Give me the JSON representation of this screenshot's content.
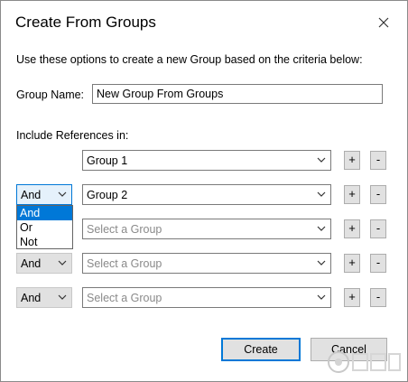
{
  "dialog": {
    "title": "Create From Groups",
    "description": "Use these options to create a new Group based on the criteria below:",
    "group_name_label": "Group Name:",
    "group_name_value": "New Group From Groups",
    "include_label": "Include References in:"
  },
  "rows": [
    {
      "operator": "",
      "group": "Group 1",
      "placeholder": false
    },
    {
      "operator": "And",
      "group": "Group 2",
      "placeholder": false
    },
    {
      "operator": "",
      "group": "Select a Group",
      "placeholder": true
    },
    {
      "operator": "And",
      "group": "Select a Group",
      "placeholder": true
    },
    {
      "operator": "And",
      "group": "Select a Group",
      "placeholder": true
    }
  ],
  "row_buttons": {
    "plus": "+",
    "minus": "-"
  },
  "dropdown": {
    "options": [
      "And",
      "Or",
      "Not"
    ],
    "selected": "And"
  },
  "buttons": {
    "create": "Create",
    "cancel": "Cancel"
  },
  "colors": {
    "accent": "#0078d7",
    "button_face": "#e1e1e1",
    "placeholder_text": "#8a8a8a"
  }
}
